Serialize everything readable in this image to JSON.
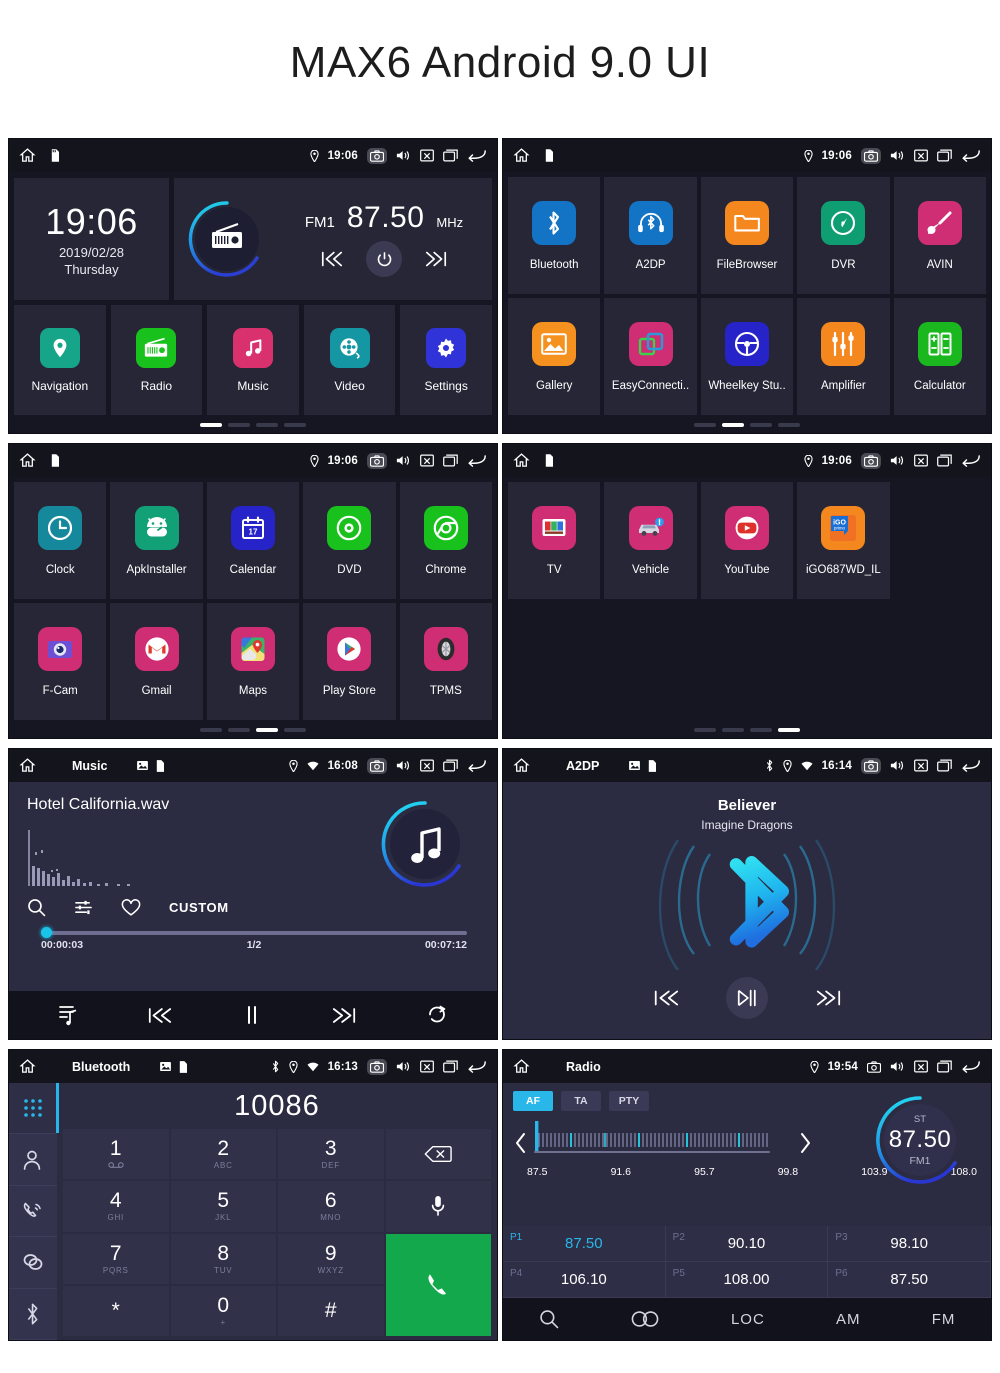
{
  "page": {
    "title": "MAX6 Android 9.0 UI"
  },
  "statusbar_icons": [
    "home-icon",
    "sdcard-icon",
    "location-icon",
    "wifi-icon",
    "screenshot-icon",
    "volume-icon",
    "close-icon",
    "recents-icon",
    "back-icon"
  ],
  "panels": {
    "home": {
      "status": {
        "time": "19:06"
      },
      "clock_widget": {
        "time": "19:06",
        "date": "2019/02/28",
        "weekday": "Thursday"
      },
      "radio_widget": {
        "band": "FM1",
        "frequency": "87.50",
        "unit": "MHz"
      },
      "apps": [
        {
          "label": "Navigation",
          "icon": "navigation-pin-icon",
          "color": "#17a589"
        },
        {
          "label": "Radio",
          "icon": "radio-icon",
          "color": "#18c11c"
        },
        {
          "label": "Music",
          "icon": "music-note-icon",
          "color": "#d8316d"
        },
        {
          "label": "Video",
          "icon": "film-reel-icon",
          "color": "#1596a3"
        },
        {
          "label": "Settings",
          "icon": "gear-icon",
          "color": "#2f33d8"
        }
      ],
      "page_dots": {
        "count": 4,
        "active": 0
      }
    },
    "drawer1": {
      "status": {
        "time": "19:06"
      },
      "apps": [
        {
          "label": "Bluetooth",
          "icon": "bluetooth-icon",
          "color": "#1373c4"
        },
        {
          "label": "A2DP",
          "icon": "bluetooth-headset-icon",
          "color": "#1373c4"
        },
        {
          "label": "FileBrowser",
          "icon": "folder-icon",
          "color": "#f5871f"
        },
        {
          "label": "DVR",
          "icon": "dashcam-gauge-icon",
          "color": "#0f9d72"
        },
        {
          "label": "AVIN",
          "icon": "av-plug-icon",
          "color": "#cf2d74"
        },
        {
          "label": "Gallery",
          "icon": "photo-icon",
          "color": "#f5921f"
        },
        {
          "label": "EasyConnecti..",
          "icon": "easyconnection-icon",
          "color": "#cf2d74"
        },
        {
          "label": "Wheelkey Stu..",
          "icon": "steering-wheel-icon",
          "color": "#2623c9"
        },
        {
          "label": "Amplifier",
          "icon": "sliders-icon",
          "color": "#f5871f"
        },
        {
          "label": "Calculator",
          "icon": "calculator-icon",
          "color": "#1ab81e"
        }
      ],
      "page_dots": {
        "count": 4,
        "active": 1
      }
    },
    "drawer2": {
      "status": {
        "time": "19:06"
      },
      "apps": [
        {
          "label": "Clock",
          "icon": "clock-icon",
          "color": "#15899b"
        },
        {
          "label": "ApkInstaller",
          "icon": "android-robot-icon",
          "color": "#12a177"
        },
        {
          "label": "Calendar",
          "icon": "calendar-icon",
          "color": "#2623c9",
          "day": "17"
        },
        {
          "label": "DVD",
          "icon": "disc-icon",
          "color": "#18c11c"
        },
        {
          "label": "Chrome",
          "icon": "chrome-icon",
          "color": "#18c11c"
        },
        {
          "label": "F-Cam",
          "icon": "camera-lens-icon",
          "color": "#cf2d74"
        },
        {
          "label": "Gmail",
          "icon": "gmail-envelope-icon",
          "color": "#cf2d74"
        },
        {
          "label": "Maps",
          "icon": "maps-pin-icon",
          "color": "#cf2d74"
        },
        {
          "label": "Play Store",
          "icon": "play-store-icon",
          "color": "#cf2d74"
        },
        {
          "label": "TPMS",
          "icon": "tire-icon",
          "color": "#cf2d74"
        }
      ],
      "page_dots": {
        "count": 4,
        "active": 2
      }
    },
    "drawer3": {
      "status": {
        "time": "19:06"
      },
      "apps": [
        {
          "label": "TV",
          "icon": "tv-icon",
          "color": "#cf2d74"
        },
        {
          "label": "Vehicle",
          "icon": "car-icon",
          "color": "#cf2d74"
        },
        {
          "label": "YouTube",
          "icon": "youtube-icon",
          "color": "#cf2d74"
        },
        {
          "label": "iGO687WD_IL",
          "icon": "igo-primo-icon",
          "color": "#f5871f"
        }
      ],
      "page_dots": {
        "count": 4,
        "active": 3
      }
    },
    "music": {
      "status": {
        "title": "Music",
        "time": "16:08"
      },
      "song": "Hotel California.wav",
      "tools": {
        "search": "search-icon",
        "equalizer": "equalizer-icon",
        "favorite": "heart-icon",
        "eq_preset": "CUSTOM"
      },
      "progress": {
        "elapsed": "00:00:03",
        "track": "1/2",
        "total": "00:07:12",
        "percent": 1
      },
      "controls": [
        "playlist-icon",
        "previous-icon",
        "pause-icon",
        "next-icon",
        "repeat-icon"
      ]
    },
    "a2dp": {
      "status": {
        "title": "A2DP",
        "time": "16:14"
      },
      "track_title": "Believer",
      "artist": "Imagine Dragons",
      "controls": [
        "previous-icon",
        "play-pause-icon",
        "next-icon"
      ]
    },
    "bluetooth": {
      "status": {
        "title": "Bluetooth",
        "time": "16:13"
      },
      "number": "10086",
      "side_items": [
        "dialpad-icon",
        "contacts-icon",
        "call-history-icon",
        "sync-icon",
        "bluetooth-icon"
      ],
      "keys": [
        {
          "digit": "1",
          "sub": "∞"
        },
        {
          "digit": "2",
          "sub": "ABC"
        },
        {
          "digit": "3",
          "sub": "DEF"
        },
        {
          "digit": "",
          "sub": "",
          "icon": "backspace-icon"
        },
        {
          "digit": "4",
          "sub": "GHI"
        },
        {
          "digit": "5",
          "sub": "JKL"
        },
        {
          "digit": "6",
          "sub": "MNO"
        },
        {
          "digit": "",
          "sub": "",
          "icon": "microphone-icon"
        },
        {
          "digit": "7",
          "sub": "PQRS"
        },
        {
          "digit": "8",
          "sub": "TUV"
        },
        {
          "digit": "9",
          "sub": "WXYZ"
        },
        {
          "digit": "",
          "sub": "",
          "icon": "call-icon"
        },
        {
          "digit": "*",
          "sub": ""
        },
        {
          "digit": "0",
          "sub": "+"
        },
        {
          "digit": "#",
          "sub": ""
        }
      ]
    },
    "radio": {
      "status": {
        "title": "Radio",
        "time": "19:54"
      },
      "rds": [
        {
          "label": "AF",
          "active": true
        },
        {
          "label": "TA",
          "active": false
        },
        {
          "label": "PTY",
          "active": false
        }
      ],
      "tick_labels": [
        "87.5",
        "91.6",
        "95.7",
        "99.8",
        "103.9",
        "108.0"
      ],
      "display": {
        "stereo": "ST",
        "frequency": "87.50",
        "band": "FM1"
      },
      "presets": [
        {
          "slot": "P1",
          "freq": "87.50",
          "active": true
        },
        {
          "slot": "P2",
          "freq": "90.10",
          "active": false
        },
        {
          "slot": "P3",
          "freq": "98.10",
          "active": false
        },
        {
          "slot": "P4",
          "freq": "106.10",
          "active": false
        },
        {
          "slot": "P5",
          "freq": "108.00",
          "active": false
        },
        {
          "slot": "P6",
          "freq": "87.50",
          "active": false
        }
      ],
      "bottom_bar": [
        {
          "label": "",
          "icon": "search-icon"
        },
        {
          "label": "",
          "icon": "stereo-icon"
        },
        {
          "label": "LOC",
          "icon": ""
        },
        {
          "label": "AM",
          "icon": ""
        },
        {
          "label": "FM",
          "icon": ""
        }
      ]
    }
  },
  "colors": {
    "accent_cyan": "#29b6e8",
    "accent_blue": "#2b54d6",
    "panel_bg": "#2b2b41",
    "tile_bg": "#262636",
    "statusbar_bg": "#14141d",
    "call_green": "#12a84b"
  }
}
